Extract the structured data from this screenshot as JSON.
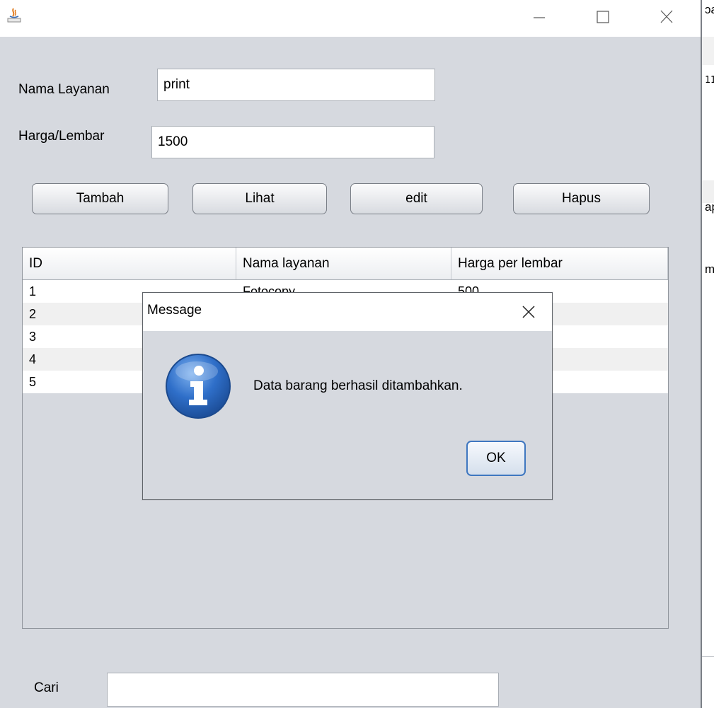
{
  "window": {
    "minimize_glyph": "—",
    "maximize_glyph": "☐",
    "close_glyph": "✕"
  },
  "form": {
    "nama_layanan_label": "Nama Layanan",
    "nama_layanan_value": "print",
    "harga_label": "Harga/Lembar",
    "harga_value": "1500"
  },
  "buttons": {
    "tambah": "Tambah",
    "lihat": "Lihat",
    "edit": "edit",
    "hapus": "Hapus"
  },
  "table": {
    "headers": [
      "ID",
      "Nama layanan",
      "Harga per lembar"
    ],
    "rows": [
      [
        "1",
        "Fotocopy",
        "500"
      ],
      [
        "2",
        "",
        ""
      ],
      [
        "3",
        "",
        ""
      ],
      [
        "4",
        "",
        ""
      ],
      [
        "5",
        "",
        ""
      ]
    ]
  },
  "search": {
    "label": "Cari",
    "value": ""
  },
  "side_window_fragments": [
    "ɔa",
    "11",
    "ap",
    "mb"
  ],
  "dialog": {
    "title": "Message",
    "message": "Data barang berhasil ditambahkan.",
    "ok_label": "OK",
    "icon": "info-icon"
  }
}
